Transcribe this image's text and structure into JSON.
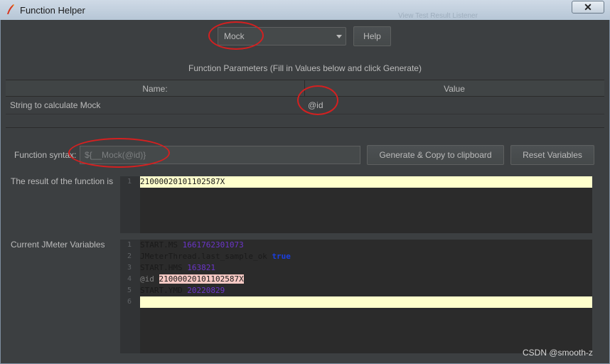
{
  "window": {
    "title": "Function Helper",
    "ghost_text": "View Test Result Listener",
    "close_glyph": "✕"
  },
  "function_select": {
    "value": "Mock"
  },
  "help_button": "Help",
  "params": {
    "heading": "Function Parameters (Fill in Values below and click Generate)",
    "columns": [
      "Name:",
      "Value"
    ],
    "rows": [
      {
        "name": "String to calculate Mock",
        "value": "@id"
      }
    ]
  },
  "syntax": {
    "label": "Function syntax:",
    "value": "${__Mock(@id)}"
  },
  "generate_button": "Generate & Copy to clipboard",
  "reset_button": "Reset Variables",
  "result": {
    "label": "The result of the function is",
    "lines": [
      {
        "num": "1",
        "text": "21000020101102587X"
      }
    ]
  },
  "variables": {
    "label": "Current JMeter Variables",
    "lines": [
      {
        "num": "1",
        "key": "START.MS",
        "value": "1661762301073"
      },
      {
        "num": "2",
        "key": "JMeterThread.last_sample_ok",
        "value": "true"
      },
      {
        "num": "3",
        "key": "START.HMS",
        "value": "163821"
      },
      {
        "num": "4",
        "key": "@id",
        "value": "21000020101102587X"
      },
      {
        "num": "5",
        "key": "START.YMD",
        "value": "20220829"
      },
      {
        "num": "6",
        "key": "",
        "value": ""
      }
    ]
  },
  "watermark": "CSDN @smooth-z",
  "colors": {
    "background": "#3c3f41",
    "highlight_line": "#ffffcc",
    "annotation_ring": "#d42020",
    "number_literal": "#6b35c9"
  }
}
